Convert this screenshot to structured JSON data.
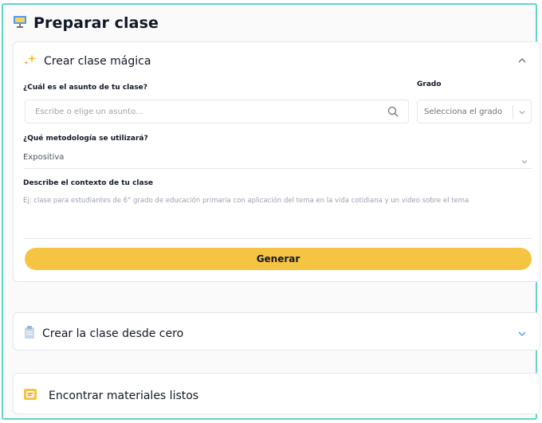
{
  "page": {
    "title": "Preparar clase",
    "accent": "#5fd6c7",
    "button_color": "#f6c443"
  },
  "magic": {
    "title": "Crear clase mágica",
    "subject_label": "¿Cuál es el asunto de tu clase?",
    "subject_placeholder": "Escribe o elige un asunto...",
    "grade_label": "Grado",
    "grade_value": "Selecciona el grado",
    "method_label": "¿Qué metodología se utilizará?",
    "method_value": "Expositiva",
    "context_label": "Describe el contexto de tu clase",
    "context_placeholder": "Ej: clase para estudiantes de 6° grado de educación primaria con aplicación del tema en la vida cotidiana y un video sobre el tema",
    "generate_label": "Generar"
  },
  "scratch": {
    "title": "Crear la clase desde cero"
  },
  "materials": {
    "title": "Encontrar materiales listos"
  },
  "icons": {
    "header": "presentation-board-icon",
    "magic": "sparkles-icon",
    "scratch": "clipboard-icon",
    "materials": "folder-icon"
  }
}
